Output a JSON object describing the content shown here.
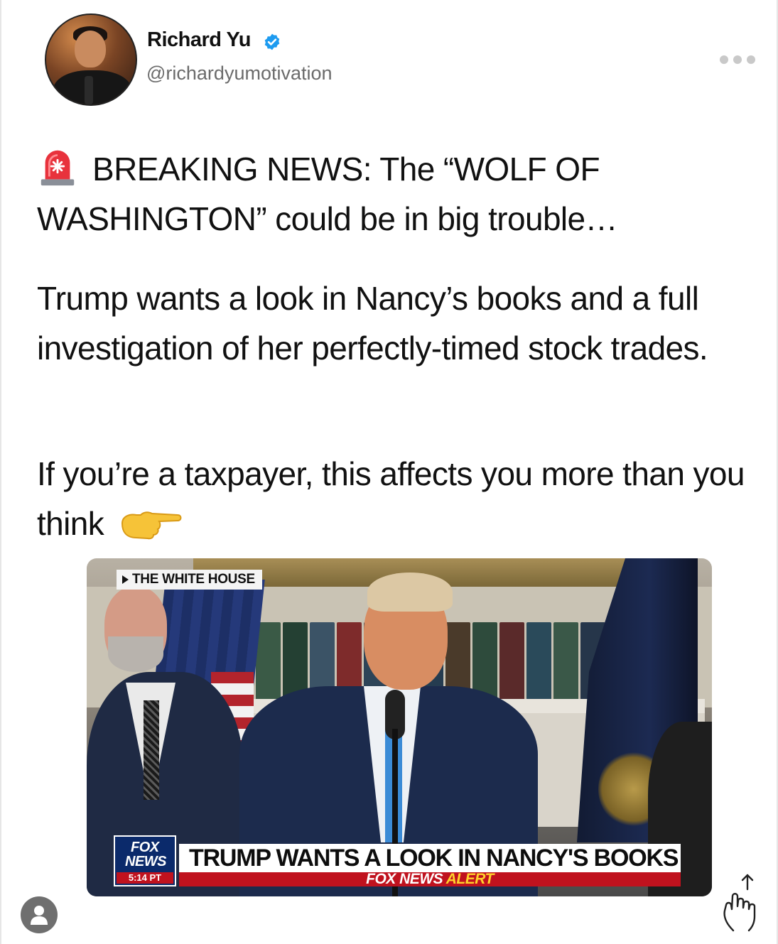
{
  "profile": {
    "name": "Richard Yu",
    "handle": "@richardyumotivation",
    "verified_color": "#1d9bf0"
  },
  "post": {
    "line1": "BREAKING NEWS: The “WOLF OF WASHINGTON” could be in big trouble…",
    "line2": "Trump wants a look in Nancy’s books and a full investigation of her perfectly-timed stock trades.",
    "line3": "If you’re a taxpayer, this affects you more than you think",
    "emoji_lead": "siren-icon",
    "emoji_trail": "pointing-right-icon"
  },
  "video": {
    "location": "THE WHITE HOUSE",
    "fox_logo_line1": "FOX",
    "fox_logo_line2": "NEWS",
    "time": "5:14 PT",
    "chyron": "TRUMP WANTS A LOOK IN NANCY'S BOOKS",
    "alert_brand": "FOX NEWS",
    "alert_word": "ALERT"
  },
  "colors": {
    "fox_blue": "#0b2a6b",
    "fox_red": "#c0121e",
    "alert_yellow": "#ffd22b",
    "handle_gray": "#6b6b6b"
  }
}
